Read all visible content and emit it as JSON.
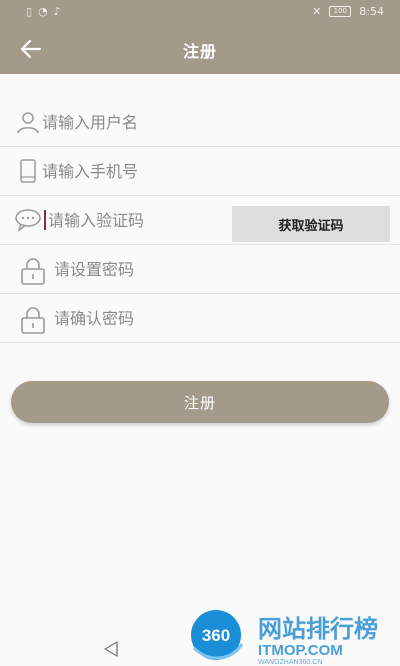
{
  "status": {
    "time": "8:54",
    "battery": "100"
  },
  "header": {
    "title": "注册"
  },
  "form": {
    "username_placeholder": "请输入用户名",
    "phone_placeholder": "请输入手机号",
    "code_placeholder": "请输入验证码",
    "get_code_label": "获取验证码",
    "password_placeholder": "请设置密码",
    "confirm_placeholder": "请确认密码"
  },
  "submit_label": "注册",
  "watermark": {
    "badge": "360",
    "title": "网站排行榜",
    "domain": "ITMOP.COM",
    "sub": "WANGZHAN360.CN"
  },
  "colors": {
    "primary": "#a49a89",
    "background": "#fafafa",
    "caret": "#8a2a50"
  },
  "icons": [
    "back-arrow",
    "user",
    "phone",
    "chat",
    "lock",
    "lock"
  ]
}
